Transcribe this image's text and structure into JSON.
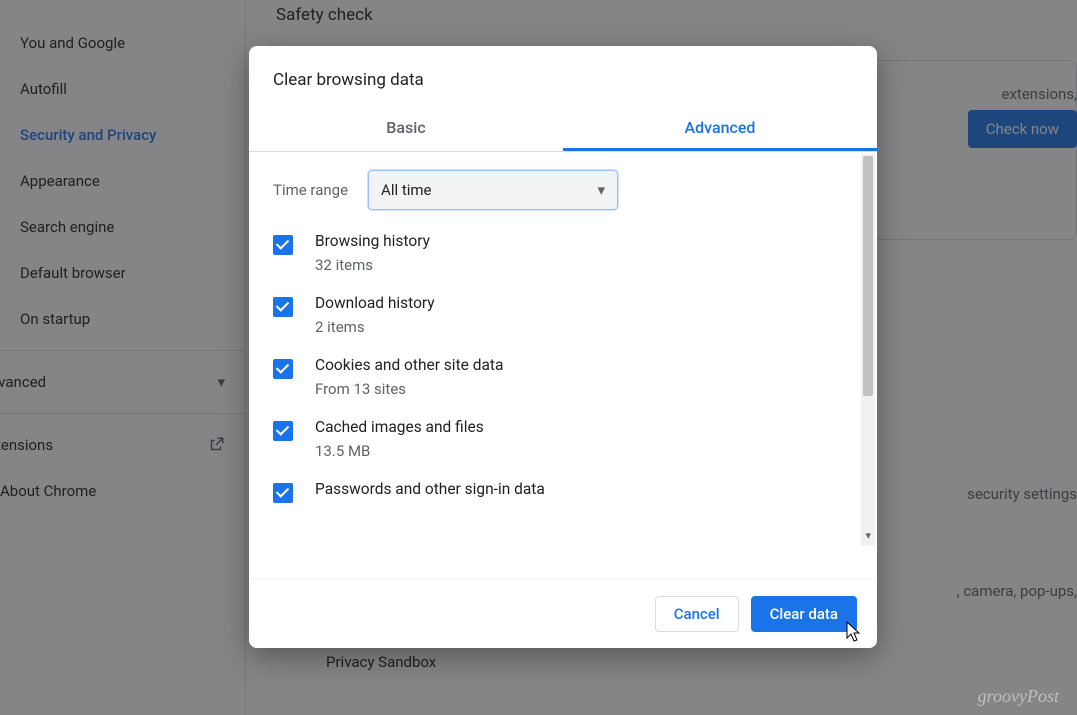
{
  "sidebar": {
    "items": [
      {
        "label": "You and Google"
      },
      {
        "label": "Autofill"
      },
      {
        "label": "Security and Privacy"
      },
      {
        "label": "Appearance"
      },
      {
        "label": "Search engine"
      },
      {
        "label": "Default browser"
      },
      {
        "label": "On startup"
      }
    ],
    "advanced_label": "Advanced",
    "extensions_label": "Extensions",
    "about_label": "About Chrome"
  },
  "background": {
    "safety_check_heading": "Safety check",
    "check_now_label": "Check now",
    "extensions_fragment": "extensions,",
    "security_settings_fragment": "security settings",
    "popups_fragment": ", camera, pop-ups,",
    "privacy_sandbox": "Privacy Sandbox"
  },
  "dialog": {
    "title": "Clear browsing data",
    "tabs": {
      "basic": "Basic",
      "advanced": "Advanced"
    },
    "time_range_label": "Time range",
    "time_range_value": "All time",
    "items": [
      {
        "title": "Browsing history",
        "sub": "32 items"
      },
      {
        "title": "Download history",
        "sub": "2 items"
      },
      {
        "title": "Cookies and other site data",
        "sub": "From 13 sites"
      },
      {
        "title": "Cached images and files",
        "sub": "13.5 MB"
      },
      {
        "title": "Passwords and other sign-in data",
        "sub": ""
      }
    ],
    "cancel": "Cancel",
    "clear": "Clear data"
  },
  "watermark": "groovyPost"
}
